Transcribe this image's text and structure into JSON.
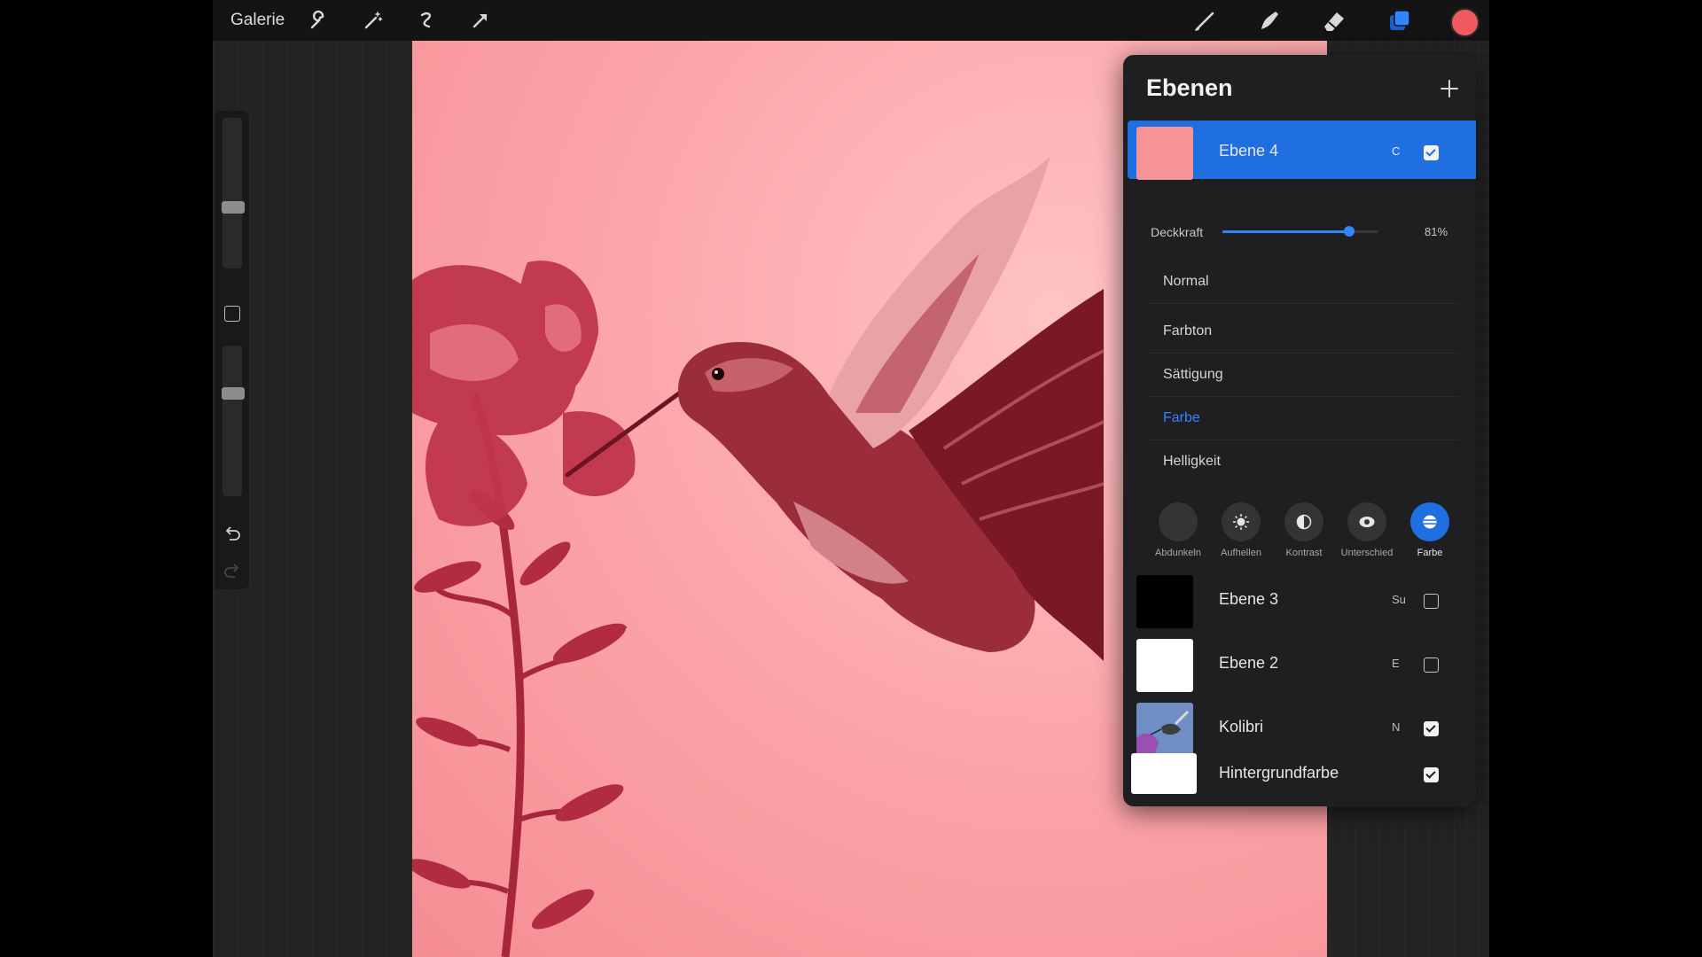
{
  "topbar": {
    "gallery_label": "Galerie",
    "left_tools": [
      "wrench-icon",
      "magic-wand-icon",
      "selection-icon",
      "transform-arrow-icon"
    ],
    "right_tools": [
      "brush-icon",
      "smudge-icon",
      "eraser-icon",
      "layers-icon"
    ],
    "current_color": "#f15a5f"
  },
  "sidebar": {
    "size_slider_level": 0.6,
    "opacity_slider_level": 0.3
  },
  "canvas": {
    "subject": "hummingbird",
    "tint_color": "#f9a3a7"
  },
  "layers_panel": {
    "title": "Ebenen",
    "accent_color": "#1f6fe0",
    "active_layer": {
      "name": "Ebene 4",
      "mode_short": "C",
      "visible": true,
      "thumb_color": "#f59395"
    },
    "opacity": {
      "label": "Deckkraft",
      "value_text": "81%",
      "value": 0.81
    },
    "blend_modes": [
      {
        "label": "Normal",
        "selected": false
      },
      {
        "label": "Farbton",
        "selected": false
      },
      {
        "label": "Sättigung",
        "selected": false
      },
      {
        "label": "Farbe",
        "selected": true
      },
      {
        "label": "Helligkeit",
        "selected": false
      }
    ],
    "blend_categories": [
      {
        "label": "Abdunkeln",
        "icon": "moon-icon",
        "selected": false
      },
      {
        "label": "Aufhellen",
        "icon": "sun-icon",
        "selected": false
      },
      {
        "label": "Kontrast",
        "icon": "contrast-icon",
        "selected": false
      },
      {
        "label": "Unterschied",
        "icon": "eye-icon",
        "selected": false
      },
      {
        "label": "Farbe",
        "icon": "color-icon",
        "selected": true
      }
    ],
    "layers": [
      {
        "name": "Ebene 3",
        "mode_short": "Su",
        "visible": false,
        "thumb_color": "#000000"
      },
      {
        "name": "Ebene 2",
        "mode_short": "E",
        "visible": false,
        "thumb_color": "#ffffff"
      },
      {
        "name": "Kolibri",
        "mode_short": "N",
        "visible": true,
        "thumb_color": "#5a7fb6"
      },
      {
        "name": "Hintergrundfarbe",
        "mode_short": "",
        "visible": true,
        "thumb_color": "#ffffff"
      }
    ]
  }
}
